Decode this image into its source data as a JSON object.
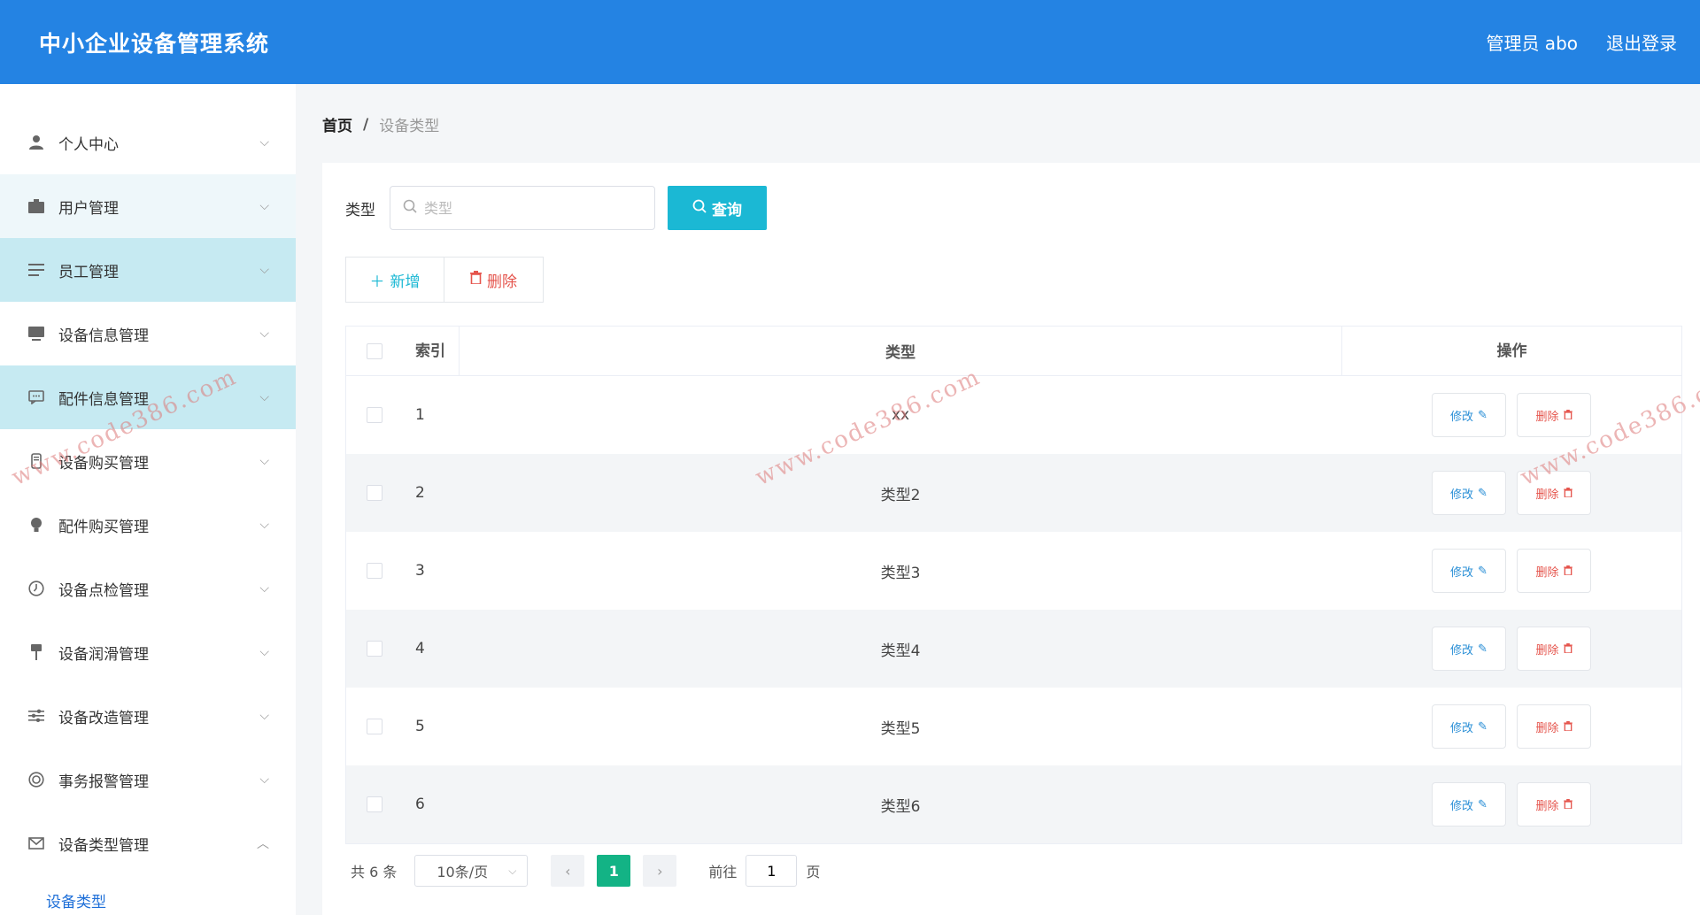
{
  "header": {
    "app_title": "中小企业设备管理系统",
    "user_label": "管理员 abo",
    "logout_label": "退出登录"
  },
  "sidebar": {
    "items": [
      {
        "label": "个人中心",
        "icon": "user-icon"
      },
      {
        "label": "用户管理",
        "icon": "briefcase-icon"
      },
      {
        "label": "员工管理",
        "icon": "list-icon"
      },
      {
        "label": "设备信息管理",
        "icon": "monitor-icon"
      },
      {
        "label": "配件信息管理",
        "icon": "chat-icon"
      },
      {
        "label": "设备购买管理",
        "icon": "phone-icon"
      },
      {
        "label": "配件购买管理",
        "icon": "bulb-icon"
      },
      {
        "label": "设备点检管理",
        "icon": "clock-icon"
      },
      {
        "label": "设备润滑管理",
        "icon": "pin-icon"
      },
      {
        "label": "设备改造管理",
        "icon": "sliders-icon"
      },
      {
        "label": "事务报警管理",
        "icon": "alarm-icon"
      },
      {
        "label": "设备类型管理",
        "icon": "mail-icon"
      }
    ],
    "submenu": {
      "label": "设备类型"
    }
  },
  "breadcrumb": {
    "home": "首页",
    "sep": "/",
    "current": "设备类型"
  },
  "search": {
    "label": "类型",
    "placeholder": "类型",
    "button": "查询"
  },
  "actions": {
    "add": "新增",
    "delete": "删除"
  },
  "table": {
    "headers": {
      "index": "索引",
      "type": "类型",
      "ops": "操作"
    },
    "edit_label": "修改",
    "delete_label": "删除",
    "rows": [
      {
        "index": "1",
        "type": "xx"
      },
      {
        "index": "2",
        "type": "类型2"
      },
      {
        "index": "3",
        "type": "类型3"
      },
      {
        "index": "4",
        "type": "类型4"
      },
      {
        "index": "5",
        "type": "类型5"
      },
      {
        "index": "6",
        "type": "类型6"
      }
    ]
  },
  "pagination": {
    "total": "共 6 条",
    "page_size": "10条/页",
    "current_page": "1",
    "jump_label": "前往",
    "jump_value": "1",
    "page_suffix": "页"
  },
  "watermark": "www.code386.com",
  "colors": {
    "header": "#2483e3",
    "accent": "#1bb8d4",
    "active_menu": "#c6eaf2",
    "danger": "#e5544c",
    "pager_active": "#13b385"
  }
}
